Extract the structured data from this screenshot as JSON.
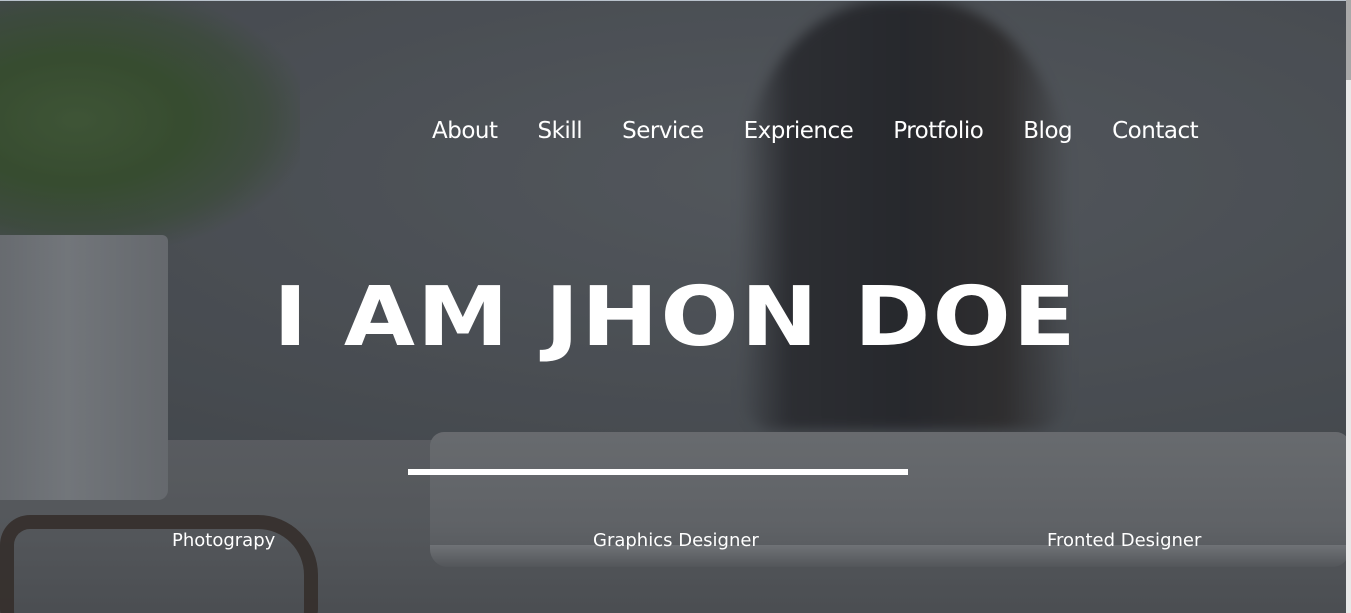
{
  "nav": {
    "items": [
      {
        "label": "About"
      },
      {
        "label": "Skill"
      },
      {
        "label": "Service"
      },
      {
        "label": "Exprience"
      },
      {
        "label": "Protfolio"
      },
      {
        "label": "Blog"
      },
      {
        "label": "Contact"
      }
    ]
  },
  "hero": {
    "headline": "I AM JHON DOE",
    "roles": [
      "Photograpy",
      "Graphics Designer",
      "Fronted Designer"
    ]
  },
  "colors": {
    "text": "#ffffff",
    "overlay": "#50555a"
  }
}
